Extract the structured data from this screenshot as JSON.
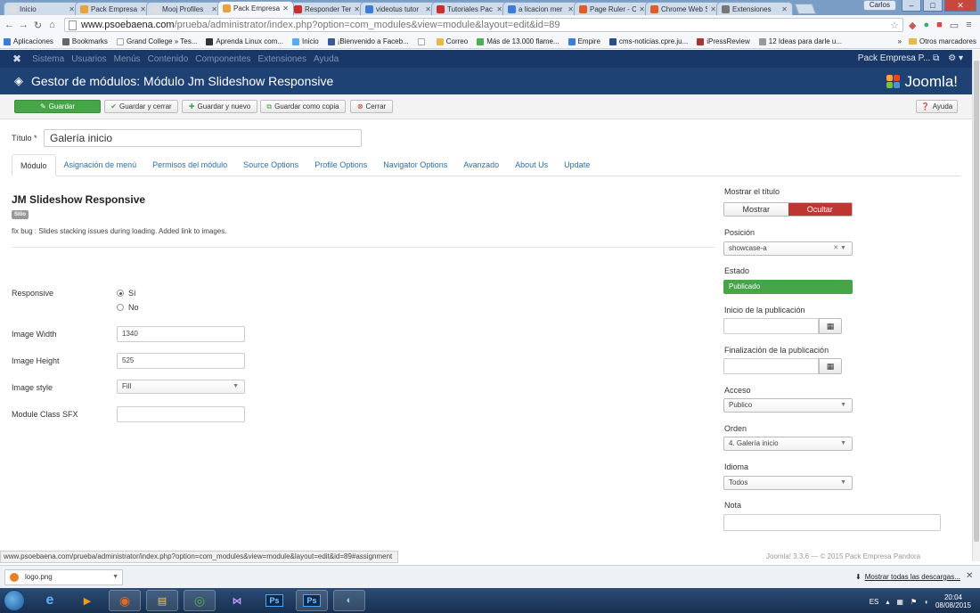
{
  "browser": {
    "tabs": [
      {
        "title": "Inicio",
        "color": "#dddddd"
      },
      {
        "title": "Pack Empresa",
        "color": "#e9a23b"
      },
      {
        "title": "Mooj Profiles",
        "color": "#dddddd"
      },
      {
        "title": "Pack Empresa",
        "color": "#e9a23b",
        "active": true
      },
      {
        "title": "Responder Ter",
        "color": "#c9302c"
      },
      {
        "title": "videotus tutor",
        "color": "#3b7dd8"
      },
      {
        "title": "Tutoriales Pac",
        "color": "#c9302c"
      },
      {
        "title": "a licacion mer",
        "color": "#3b7dd8"
      },
      {
        "title": "Page Ruler - Cl",
        "color": "#e05d2a"
      },
      {
        "title": "Chrome Web S",
        "color": "#e05d2a"
      },
      {
        "title": "Extensiones",
        "color": "#777777"
      }
    ],
    "user": "Carlos",
    "url_host": "www.psoebaena.com",
    "url_rest": "/prueba/administrator/index.php?option=com_modules&view=module&layout=edit&id=89",
    "bookmarks": [
      {
        "label": "Aplicaciones",
        "color": "#3b7dd8"
      },
      {
        "label": "Bookmarks",
        "color": "#666666"
      },
      {
        "label": "Grand College » Tes...",
        "color": "#ffffff"
      },
      {
        "label": "Aprenda Linux com...",
        "color": "#333333"
      },
      {
        "label": "Inicio",
        "color": "#55acee"
      },
      {
        "label": "¡Bienvenido a Faceb...",
        "color": "#3b5998"
      },
      {
        "label": "",
        "color": "#ffffff"
      },
      {
        "label": "Correo",
        "color": "#e8b84a"
      },
      {
        "label": "Más de 13.000 flame...",
        "color": "#4caf50"
      },
      {
        "label": "Empire",
        "color": "#3b7dd8"
      },
      {
        "label": "cms-noticias.cpre.ju...",
        "color": "#2c4b8a"
      },
      {
        "label": "iPressReview",
        "color": "#a33"
      },
      {
        "label": "12 Ideas para darle u...",
        "color": "#999999"
      }
    ],
    "bookmarks_more": "»",
    "other_bookmarks": "Otros marcadores"
  },
  "joomla": {
    "nav": [
      "Sistema",
      "Usuarios",
      "Menús",
      "Contenido",
      "Componentes",
      "Extensiones",
      "Ayuda"
    ],
    "site_name": "Pack Empresa P...",
    "page_title": "Gestor de módulos: Módulo Jm Slideshow Responsive",
    "brand": "Joomla!",
    "toolbar": {
      "save": "Guardar",
      "save_close": "Guardar y cerrar",
      "save_new": "Guardar y nuevo",
      "save_copy": "Guardar como copia",
      "close": "Cerrar",
      "help": "Ayuda"
    },
    "title_label": "Título *",
    "title_value": "Galería inicio",
    "tabs": [
      "Módulo",
      "Asignación de menú",
      "Permisos del módulo",
      "Source Options",
      "Profile Options",
      "Navigator Options",
      "Avanzado",
      "About Us",
      "Update"
    ],
    "module_name": "JM Slideshow Responsive",
    "badge": "Sitio",
    "description": "fix bug : Slides stacking issues during loading. Added link to images.",
    "fields": {
      "responsive_label": "Responsive",
      "responsive_yes": "Sí",
      "responsive_no": "No",
      "width_label": "Image Width",
      "width_value": "1340",
      "height_label": "Image Height",
      "height_value": "525",
      "style_label": "Image style",
      "style_value": "Fill",
      "sfx_label": "Module Class SFX",
      "sfx_value": ""
    },
    "side": {
      "show_title_label": "Mostrar el título",
      "show": "Mostrar",
      "hide": "Ocultar",
      "position_label": "Posición",
      "position_value": "showcase-a",
      "state_label": "Estado",
      "state_value": "Publicado",
      "publish_up_label": "Inicio de la publicación",
      "publish_down_label": "Finalización de la publicación",
      "access_label": "Acceso",
      "access_value": "Publico",
      "order_label": "Orden",
      "order_value": "4. Galería inicio",
      "language_label": "Idioma",
      "language_value": "Todos",
      "note_label": "Nota"
    },
    "footer": "Joomla! 3.3.6 — © 2015 Pack Empresa Pandora"
  },
  "status_url": "www.psoebaena.com/prueba/administrator/index.php?option=com_modules&view=module&layout=edit&id=89#assignment",
  "downloads": {
    "file": "logo.png",
    "show_all": "Mostrar todas las descargas..."
  },
  "taskbar": {
    "lang": "ES",
    "time": "20:04",
    "date": "08/08/2015"
  }
}
